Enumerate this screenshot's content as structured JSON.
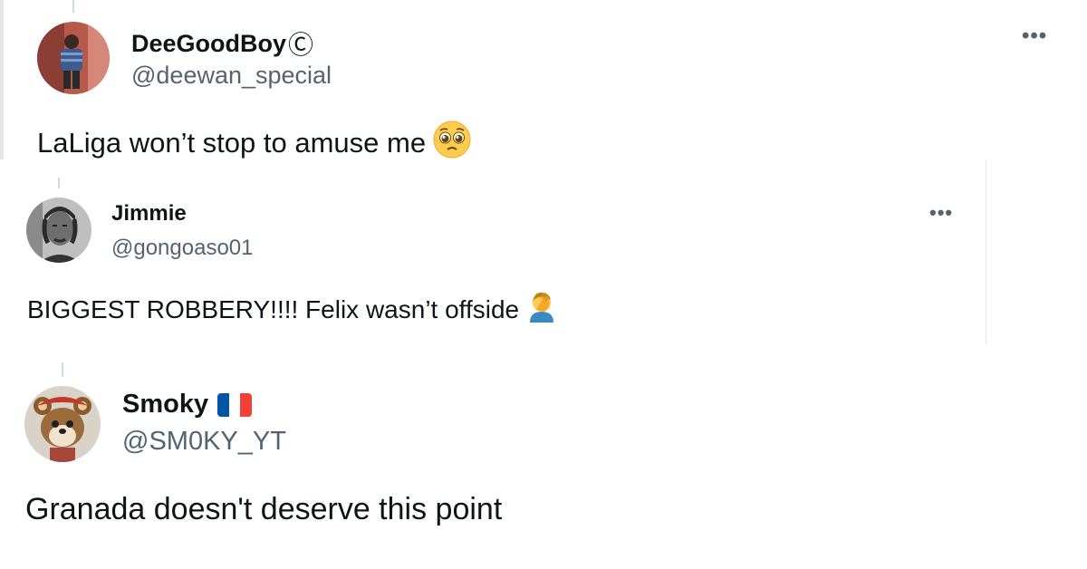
{
  "tweets": [
    {
      "name": "DeeGoodBoy",
      "name_suffix": "Ⓒ",
      "handle": "@deewan_special",
      "more_label": "•••",
      "text": "LaLiga won’t stop to amuse me",
      "emoji": "pleading-face-icon"
    },
    {
      "name": "Jimmie",
      "handle": "@gongoaso01",
      "more_label": "•••",
      "text": "BIGGEST ROBBERY!!!! Felix wasn’t offside",
      "emoji": "face-palm-icon"
    },
    {
      "name": "Smoky",
      "flag": "france-flag-icon",
      "handle": "@SM0KY_YT",
      "text": "Granada doesn't deserve this point"
    }
  ],
  "colors": {
    "text": "#0f1419",
    "secondary": "#536471",
    "thread_line": "#cfd9de",
    "flag_blue": "#0055a4",
    "flag_white": "#ffffff",
    "flag_red": "#ef4135"
  }
}
